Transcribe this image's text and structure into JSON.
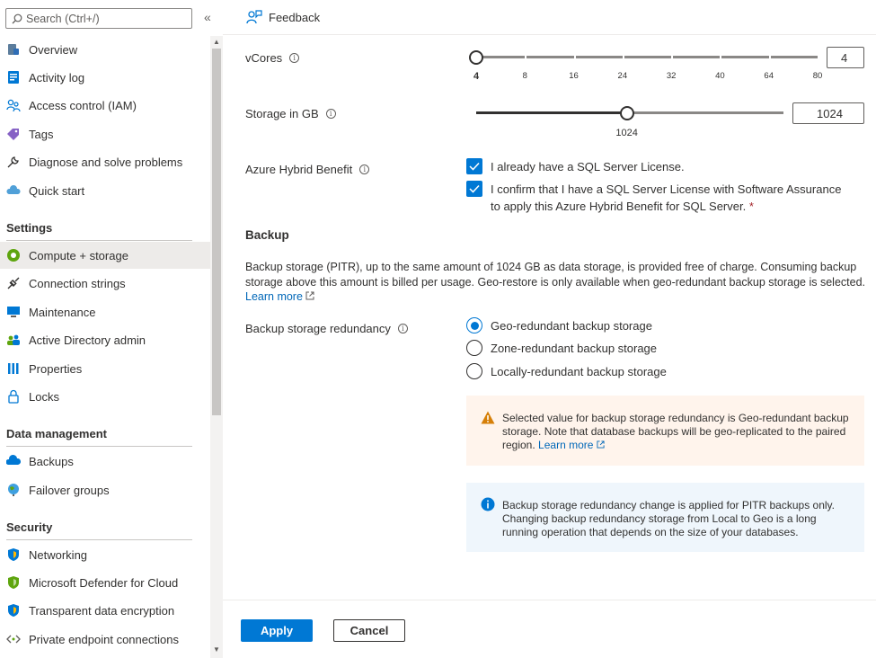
{
  "sidebar": {
    "search_placeholder": "Search (Ctrl+/)",
    "collapse_label": "«",
    "items": [
      {
        "label": "Overview",
        "icon": "sql-database-icon"
      },
      {
        "label": "Activity log",
        "icon": "activity-log-icon"
      },
      {
        "label": "Access control (IAM)",
        "icon": "people-icon"
      },
      {
        "label": "Tags",
        "icon": "tag-icon"
      },
      {
        "label": "Diagnose and solve problems",
        "icon": "wrench-icon"
      },
      {
        "label": "Quick start",
        "icon": "cloud-bolt-icon"
      }
    ],
    "sections": [
      {
        "title": "Settings",
        "items": [
          {
            "label": "Compute + storage",
            "icon": "compute-icon",
            "selected": true
          },
          {
            "label": "Connection strings",
            "icon": "plug-icon"
          },
          {
            "label": "Maintenance",
            "icon": "monitor-icon"
          },
          {
            "label": "Active Directory admin",
            "icon": "people-icon"
          },
          {
            "label": "Properties",
            "icon": "properties-icon"
          },
          {
            "label": "Locks",
            "icon": "lock-icon"
          }
        ]
      },
      {
        "title": "Data management",
        "items": [
          {
            "label": "Backups",
            "icon": "cloud-backup-icon"
          },
          {
            "label": "Failover groups",
            "icon": "globe-icon"
          }
        ]
      },
      {
        "title": "Security",
        "items": [
          {
            "label": "Networking",
            "icon": "shield-icon"
          },
          {
            "label": "Microsoft Defender for Cloud",
            "icon": "defender-shield-icon"
          },
          {
            "label": "Transparent data encryption",
            "icon": "shield-icon"
          },
          {
            "label": "Private endpoint connections",
            "icon": "endpoint-icon"
          }
        ]
      }
    ]
  },
  "header": {
    "feedback_label": "Feedback"
  },
  "vcores": {
    "label": "vCores",
    "value": "4",
    "ticks": [
      "4",
      "8",
      "16",
      "24",
      "32",
      "40",
      "64",
      "80"
    ],
    "selected_index": 0
  },
  "storage": {
    "label": "Storage in GB",
    "value": "1024",
    "slider_label": "1024",
    "slider_fraction": 0.49
  },
  "hybrid": {
    "label": "Azure Hybrid Benefit",
    "option1": "I already have a SQL Server License.",
    "option2": "I confirm that I have a SQL Server License with Software Assurance to apply this Azure Hybrid Benefit for SQL Server.",
    "required_mark": "*"
  },
  "backup": {
    "heading": "Backup",
    "description": "Backup storage (PITR), up to the same amount of 1024 GB as data storage, is provided free of charge. Consuming backup storage above this amount is billed per usage. Geo-restore is only available when geo-redundant backup storage is selected.",
    "learn_more": "Learn more",
    "redundancy_label": "Backup storage redundancy",
    "options": [
      "Geo-redundant backup storage",
      "Zone-redundant backup storage",
      "Locally-redundant backup storage"
    ],
    "selected_option": 0,
    "warning": "Selected value for backup storage redundancy is Geo-redundant backup storage. Note that database backups will be geo-replicated to the paired region.",
    "warning_link": "Learn more",
    "info": "Backup storage redundancy change is applied for PITR backups only. Changing backup redundancy storage from Local to Geo is a long running operation that depends on the size of your databases."
  },
  "footer": {
    "apply_label": "Apply",
    "cancel_label": "Cancel"
  },
  "colors": {
    "accent": "#0078d4",
    "warning_bg": "#fff4ec",
    "info_bg": "#eff6fc",
    "warning_icon": "#d67f08"
  }
}
